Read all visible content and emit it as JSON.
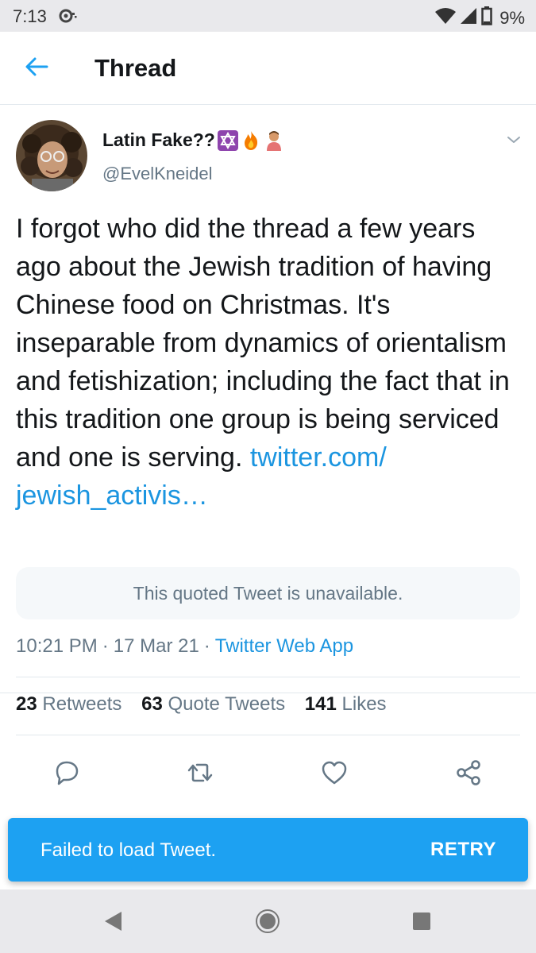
{
  "status_bar": {
    "time": "7:13",
    "battery": "9%",
    "icons": [
      "notification-icon",
      "wifi-icon",
      "signal-icon",
      "battery-icon"
    ]
  },
  "header": {
    "title": "Thread",
    "back_icon": "back-arrow-icon"
  },
  "tweet": {
    "display_name": "Latin Fake??",
    "name_emojis": [
      "star-of-david-emoji",
      "fire-emoji",
      "facepalm-emoji"
    ],
    "handle": "@EvelKneidel",
    "text": "I forgot who did the thread a few years ago about the Jewish tradition of having Chinese food on Christmas. It's inseparable from dynamics of orientalism and fetishization; including the fact that in this tradition one group is being serviced and one is serving.",
    "link_line1": "twitter.com/",
    "link_line2": "jewish_activis…",
    "quoted_unavailable": "This quoted Tweet is unavailable.",
    "time": "10:21 PM",
    "date": "17 Mar 21",
    "separator": "·",
    "source": "Twitter Web App",
    "stats": {
      "retweets_count": "23",
      "retweets_label": "Retweets",
      "quotes_count": "63",
      "quotes_label": "Quote Tweets",
      "likes_count": "141",
      "likes_label": "Likes"
    },
    "actions": [
      "reply-icon",
      "retweet-icon",
      "like-icon",
      "share-icon"
    ]
  },
  "snackbar": {
    "message": "Failed to load Tweet.",
    "action": "RETRY"
  },
  "nav_bar": {
    "buttons": [
      "back-triangle-icon",
      "home-circle-icon",
      "recents-square-icon"
    ]
  },
  "colors": {
    "accent": "#1da1f2",
    "link": "#1b95e0",
    "secondary_text": "#657786",
    "primary_text": "#14171a",
    "system_bar": "#e9e9ec"
  }
}
